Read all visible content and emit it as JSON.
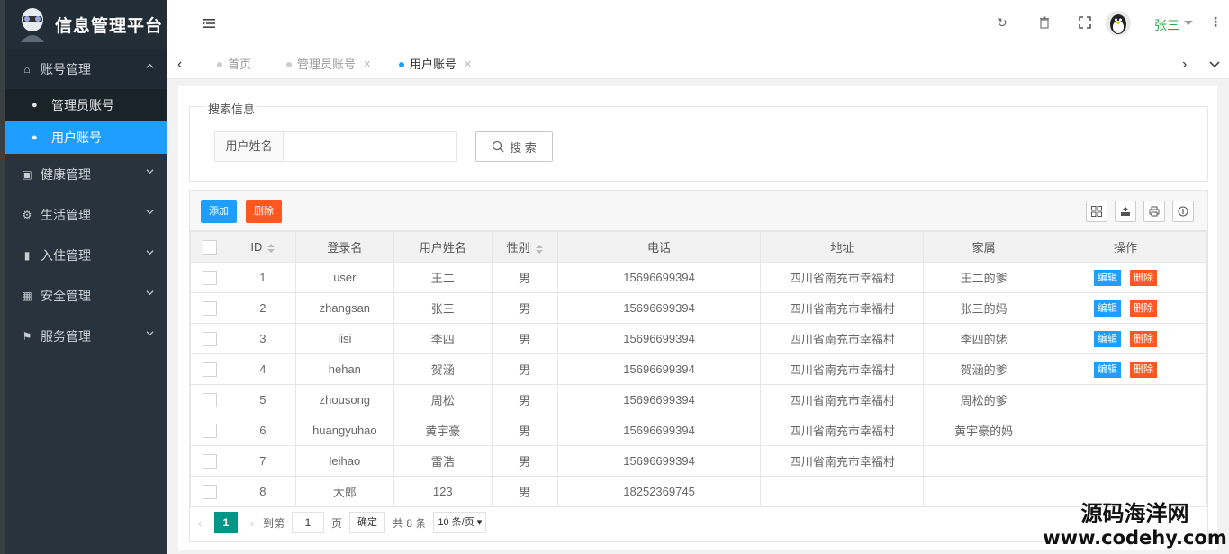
{
  "app": {
    "title": "信息管理平台"
  },
  "sidebar": {
    "groups": [
      {
        "label": "账号管理",
        "icon": "home-icon",
        "open": true,
        "items": [
          {
            "label": "管理员账号",
            "icon": "dashboard-icon",
            "active": false
          },
          {
            "label": "用户账号",
            "icon": "dashboard-icon",
            "active": true
          }
        ]
      },
      {
        "label": "健康管理",
        "icon": "window-icon"
      },
      {
        "label": "生活管理",
        "icon": "cogs-icon"
      },
      {
        "label": "入住管理",
        "icon": "file-icon"
      },
      {
        "label": "安全管理",
        "icon": "calendar-icon"
      },
      {
        "label": "服务管理",
        "icon": "flag-icon"
      }
    ]
  },
  "header": {
    "user_name": "张三",
    "icons": [
      "menu-toggle-icon",
      "refresh-icon",
      "trash-icon",
      "fullscreen-icon",
      "user-avatar",
      "more-icon"
    ]
  },
  "tabs": [
    {
      "label": "首页",
      "active": false,
      "closable": false
    },
    {
      "label": "管理员账号",
      "active": false,
      "closable": true
    },
    {
      "label": "用户账号",
      "active": true,
      "closable": true
    }
  ],
  "search": {
    "legend": "搜索信息",
    "field_label": "用户姓名",
    "field_value": "",
    "button_label": "搜 索"
  },
  "toolbar": {
    "add_label": "添加",
    "delete_label": "删除"
  },
  "table": {
    "columns": [
      "ID",
      "登录名",
      "用户姓名",
      "性别",
      "电话",
      "地址",
      "家属",
      "操作"
    ],
    "edit_label": "编辑",
    "delete_label": "删除",
    "rows": [
      {
        "id": "1",
        "login": "user",
        "name": "王二",
        "gender": "男",
        "phone": "15696699394",
        "address": "四川省南充市幸福村",
        "family": "王二的爹"
      },
      {
        "id": "2",
        "login": "zhangsan",
        "name": "张三",
        "gender": "男",
        "phone": "15696699394",
        "address": "四川省南充市幸福村",
        "family": "张三的妈"
      },
      {
        "id": "3",
        "login": "lisi",
        "name": "李四",
        "gender": "男",
        "phone": "15696699394",
        "address": "四川省南充市幸福村",
        "family": "李四的姥"
      },
      {
        "id": "4",
        "login": "hehan",
        "name": "贺涵",
        "gender": "男",
        "phone": "15696699394",
        "address": "四川省南充市幸福村",
        "family": "贺涵的爹"
      },
      {
        "id": "5",
        "login": "zhousong",
        "name": "周松",
        "gender": "男",
        "phone": "15696699394",
        "address": "四川省南充市幸福村",
        "family": "周松的爹"
      },
      {
        "id": "6",
        "login": "huangyuhao",
        "name": "黄宇豪",
        "gender": "男",
        "phone": "15696699394",
        "address": "四川省南充市幸福村",
        "family": "黄宇豪的妈"
      },
      {
        "id": "7",
        "login": "leihao",
        "name": "雷浩",
        "gender": "男",
        "phone": "15696699394",
        "address": "四川省南充市幸福村",
        "family": ""
      },
      {
        "id": "8",
        "login": "大郎",
        "name": "123",
        "gender": "男",
        "phone": "18252369745",
        "address": "",
        "family": ""
      }
    ]
  },
  "pager": {
    "current": "1",
    "goto_label": "到第",
    "input_value": "1",
    "page_label": "页",
    "ok_label": "确定",
    "total_label": "共 8 条",
    "size_label": "10 条/页"
  },
  "watermark": {
    "line1": "源码海洋网",
    "line2": "www.codehy.com"
  }
}
